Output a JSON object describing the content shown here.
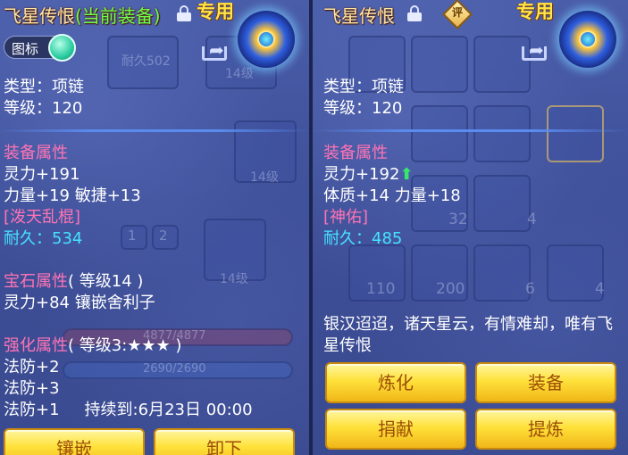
{
  "left": {
    "title": "飞星传恨",
    "current_tag": "(当前装备)",
    "exclusive": "专用",
    "toggle_label": "图标",
    "type_line": "类型：项链",
    "level_line": "等级：120",
    "equip_attr_header": "装备属性",
    "attr1": "灵力+191",
    "attr2": "力量+19 敏捷+13",
    "special": "[泼天乱棍]",
    "durability_label": "耐久：",
    "durability_value": "534",
    "gem_header": "宝石属性",
    "gem_level": "( 等级14 )",
    "gem_line": "灵力+84 镶嵌舍利子",
    "enhance_header": "强化属性",
    "enhance_level": "( 等级3:★★★ )",
    "enh1": "法防+2",
    "enh2": "法防+3",
    "enh3": "法防+1",
    "duration": "持续到:6月23日 00:00",
    "btn_inlay": "镶嵌",
    "btn_unequip": "卸下",
    "bg_texts": [
      "耐久502",
      "14级",
      "14级",
      "14级",
      "1",
      "2",
      "4877/4877",
      "2690/2690"
    ]
  },
  "right": {
    "title": "飞星传恨",
    "rate_label": "评",
    "exclusive": "专用",
    "type_line": "类型：项链",
    "level_line": "等级：120",
    "equip_attr_header": "装备属性",
    "attr1": "灵力+192",
    "attr2": "体质+14 力量+18",
    "special": "[神佑]",
    "durability_label": "耐久：",
    "durability_value": "485",
    "description": "银汉迢迢，诸天星云，有情难却，唯有飞星传恨",
    "btn_refine": "炼化",
    "btn_equip": "装备",
    "btn_donate": "捐献",
    "btn_extract": "提炼",
    "bg_counts": [
      "32",
      "4",
      "110",
      "200",
      "6",
      "4"
    ]
  },
  "colors": {
    "title": "#ffe7a8",
    "current_tag": "#6dff4a",
    "exclusive": "#ffe44a",
    "section": "#ff73b4",
    "durability": "#45e3ff",
    "button": "#ffe13a"
  }
}
